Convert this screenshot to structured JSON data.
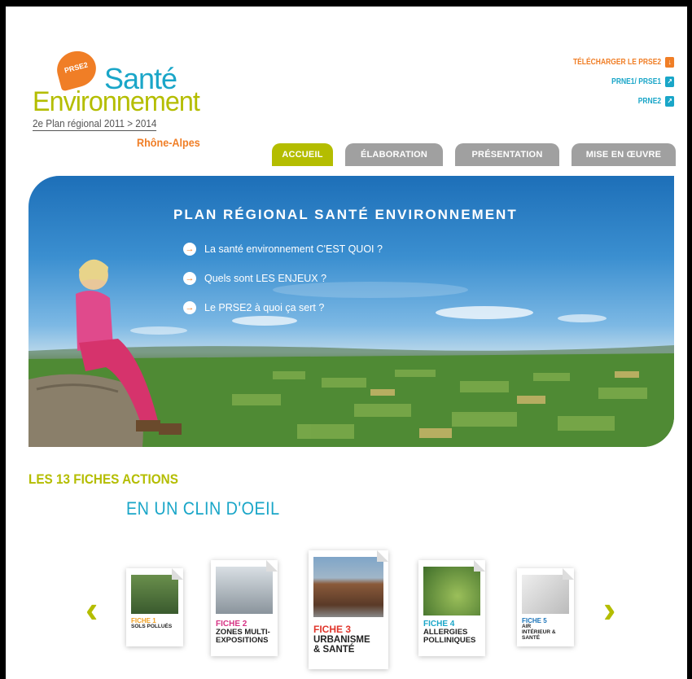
{
  "logo": {
    "bubble": "PRSE2",
    "title_line1": "Santé",
    "title_line2": "Environnement",
    "plan": "2e Plan régional 2011 > 2014",
    "region": "Rhône-Alpes"
  },
  "toplinks": [
    {
      "label": "TÉLÉCHARGER LE PRSE2",
      "icon": "download-icon",
      "color": "#f07e26"
    },
    {
      "label": "PRNE1/ PRSE1",
      "icon": "external-link-icon",
      "color": "#1aa6c8"
    },
    {
      "label": "PRNE2",
      "icon": "external-link-icon",
      "color": "#1aa6c8"
    }
  ],
  "nav": {
    "tabs": [
      {
        "label": "ACCUEIL",
        "active": true
      },
      {
        "label": "ÉLABORATION",
        "active": false
      },
      {
        "label": "PRÉSENTATION",
        "active": false
      },
      {
        "label": "MISE EN ŒUVRE",
        "active": false
      }
    ]
  },
  "hero": {
    "title": "PLAN RÉGIONAL SANTÉ ENVIRONNEMENT",
    "items": [
      "La santé environnement C'EST QUOI ?",
      "Quels sont LES ENJEUX ?",
      "Le PRSE2 à quoi ça sert ?"
    ]
  },
  "section": {
    "heading": "LES 13 FICHES ACTIONS",
    "subheading": "EN UN CLIN D'OEIL"
  },
  "carousel": {
    "prev": "‹",
    "next": "›",
    "cards": [
      {
        "num": "FICHE 1",
        "label": "SOLS POLLUÉS",
        "color": "#f0a020"
      },
      {
        "num": "FICHE 2",
        "label": "ZONES MULTI-EXPOSITIONS",
        "color": "#d63384"
      },
      {
        "num": "FICHE 3",
        "label": "URBANISME & SANTÉ",
        "color": "#e0352b"
      },
      {
        "num": "FICHE 4",
        "label": "ALLERGIES POLLINIQUES",
        "color": "#1aa6c8"
      },
      {
        "num": "FICHE 5",
        "label": "AIR INTÉRIEUR & SANTÉ",
        "color": "#1a73b8"
      }
    ]
  },
  "colors": {
    "green_accent": "#b4bd00",
    "cyan_accent": "#1aa6c8",
    "orange_accent": "#f07e26",
    "tab_inactive": "#a0a0a0"
  }
}
